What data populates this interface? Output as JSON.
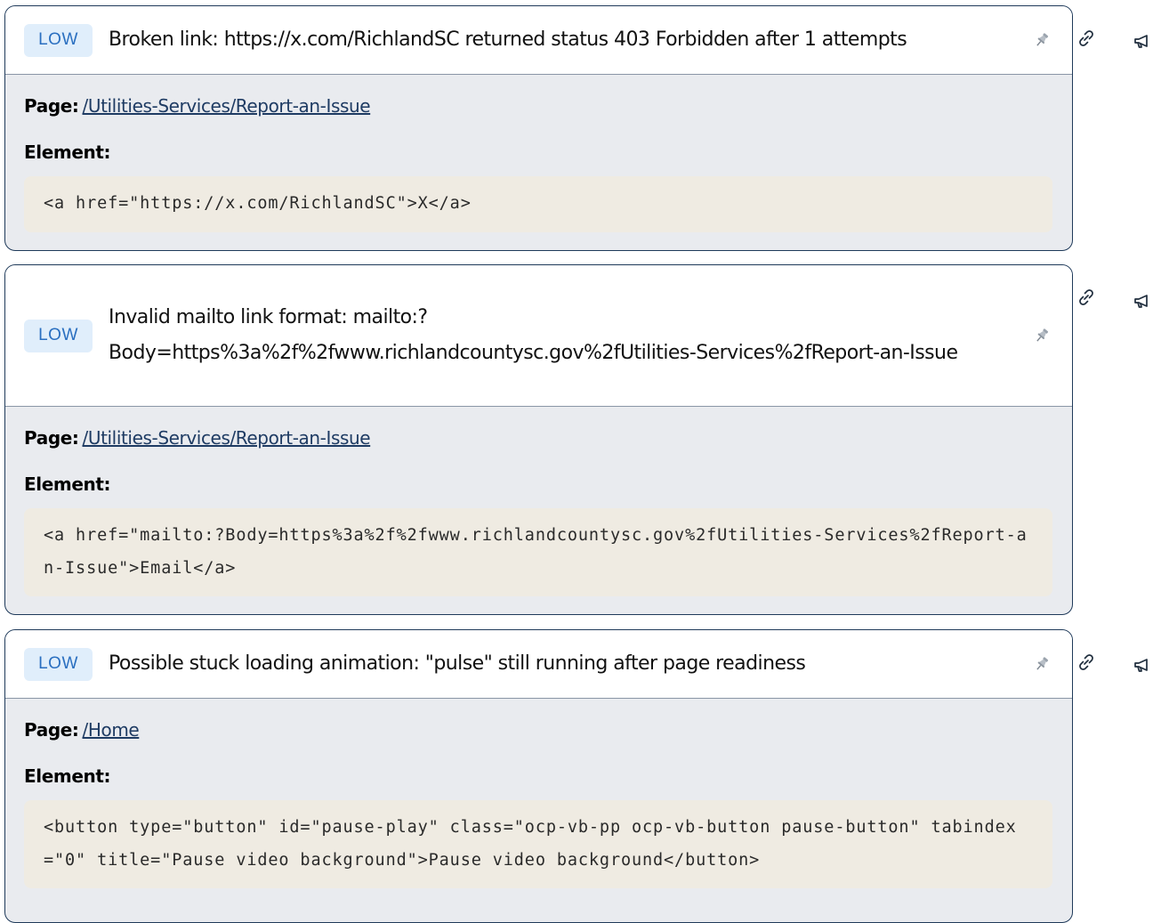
{
  "issues": [
    {
      "severity": "LOW",
      "title": "Broken link: https://x.com/RichlandSC returned status 403 Forbidden after 1 attempts",
      "page_label": "Page:",
      "page_link": "/Utilities-Services/Report-an-Issue",
      "element_label": "Element:",
      "element_code": "<a href=\"https://x.com/RichlandSC\">X</a>"
    },
    {
      "severity": "LOW",
      "title": "Invalid mailto link format: mailto:? Body=https%3a%2f%2fwww.richlandcountysc.gov%2fUtilities-Services%2fReport-an-Issue",
      "page_label": "Page:",
      "page_link": "/Utilities-Services/Report-an-Issue",
      "element_label": "Element:",
      "element_code": "<a href=\"mailto:?Body=https%3a%2f%2fwww.richlandcountysc.gov%2fUtilities-Services%2fReport-an-Issue\">Email</a>"
    },
    {
      "severity": "LOW",
      "title": "Possible stuck loading animation: \"pulse\" still running after page readiness",
      "page_label": "Page:",
      "page_link": "/Home",
      "element_label": "Element:",
      "element_code": "<button type=\"button\" id=\"pause-play\" class=\"ocp-vb-pp ocp-vb-button pause-button\" tabindex=\"0\" title=\"Pause video background\">Pause video background</button>"
    }
  ],
  "icons": {
    "pin": "pin-icon",
    "link": "link-icon",
    "megaphone": "megaphone-icon"
  },
  "colors": {
    "badge_bg": "#e0eefb",
    "badge_text": "#2a6fc0",
    "card_border": "#1f3a5a",
    "card_body": "#e9ebef",
    "code_bg": "#efebe2",
    "link": "#1e3b63"
  }
}
